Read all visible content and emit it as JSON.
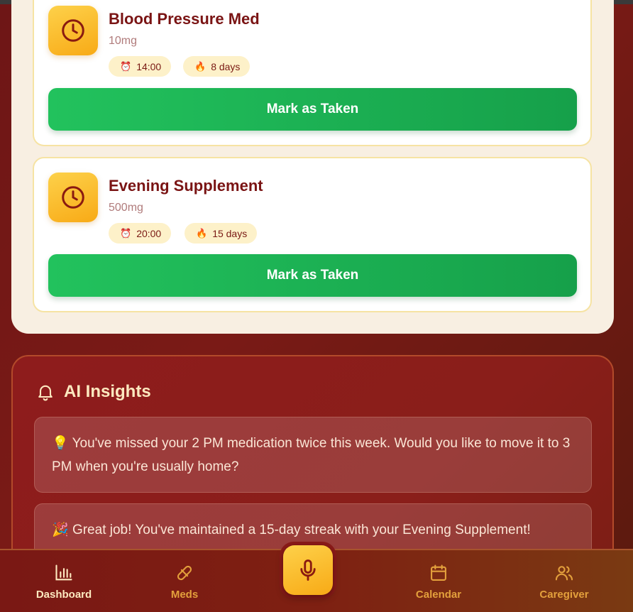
{
  "medications": [
    {
      "name": "Blood Pressure Med",
      "dose": "10mg",
      "time": "14:00",
      "streak": "8 days",
      "action_label": "Mark as Taken"
    },
    {
      "name": "Evening Supplement",
      "dose": "500mg",
      "time": "20:00",
      "streak": "15 days",
      "action_label": "Mark as Taken"
    }
  ],
  "insights": {
    "title": "AI Insights",
    "tips": [
      {
        "emoji": "💡",
        "text": "You've missed your 2 PM medication twice this week. Would you like to move it to 3 PM when you're usually home?"
      },
      {
        "emoji": "🎉",
        "text": "Great job! You've maintained a 15-day streak with your Evening Supplement!"
      }
    ]
  },
  "nav": {
    "active": "Dashboard",
    "items": [
      "Dashboard",
      "Meds",
      "Calendar",
      "Caregiver"
    ]
  },
  "icons": {
    "medication": "clock-icon",
    "time_chip": "alarm-clock-icon",
    "streak_chip": "fire-icon",
    "insights": "bell-icon",
    "voice": "microphone-icon"
  },
  "colors": {
    "accent_green": "#22c25d",
    "accent_yellow": "#f8aa16",
    "title_red": "#7a1414",
    "panel_cream": "#f8efe2",
    "nav_active": "#fde9c0",
    "nav_inactive": "#e3a03c"
  }
}
